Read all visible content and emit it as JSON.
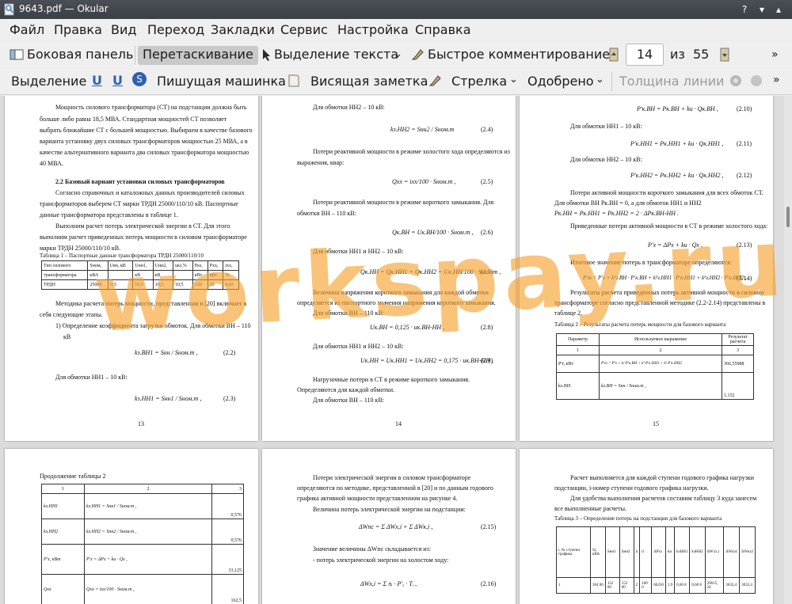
{
  "window": {
    "title": "9643.pdf — Okular"
  },
  "menu": [
    "Файл",
    "Правка",
    "Вид",
    "Переход",
    "Закладки",
    "Сервис",
    "Настройка",
    "Справка"
  ],
  "toolbar1": {
    "sidebar": "Боковая панель",
    "drag": "Перетаскивание",
    "text_select": "Выделение текста",
    "quick_comment": "Быстрое комментирование",
    "page_current": "14",
    "page_of": "из",
    "page_total": "55"
  },
  "toolbar2": {
    "select": "Выделение",
    "typewriter": "Пишущая машинка",
    "note": "Висящая заметка",
    "arrow": "Стрелка",
    "approved": "Одобрено",
    "line_width": "Толщина линии"
  },
  "watermark": "workspay.ru",
  "pages": {
    "p13": {
      "lines": [
        "Мощность силового трансформатора (СТ) на подстанции должна быть",
        "больше либо равна 18,5 МВА. Стандартная мощностей СТ позволяет",
        "выбрать ближайшие СТ с большей мощностью. Выбираем в качестве базового",
        "варианта установку двух силовых трансформаторов мощностью 25 МВА, а в",
        "качестве альтернативного варианта два силовых трансформатора мощностью",
        "40 МВА."
      ],
      "heading": "2.2 Базовый вариант установки силовых трансформаторов",
      "lines2": [
        "Согласно справочных и каталожных данных производителей силовых",
        "трансформаторов выберем СТ марки ТРДН 25000/110/10 кВ. Паспортные",
        "данные трансформатора представлены в таблице 1.",
        "Выполним расчет потерь электрической энергии в СТ. Для этого",
        "выполним расчет приведенных потерь мощности в силовом трансформаторе",
        "марки ТРДН 25000/110/10 кВ."
      ],
      "table_caption": "Таблица 1 – Паспортные данные трансформатора ТРДН 25000/110/10",
      "table_head": [
        "Тип силового",
        "Sном,",
        "Uвн, кВ",
        "Uнн1,",
        "Uнн2,",
        "uкз,%",
        "Ркз,",
        "Рхх,",
        "iхх,"
      ],
      "table_head2": [
        "трансформатора",
        "кВА",
        "",
        "кВ",
        "кВ",
        "",
        "кВт",
        "кВт",
        "%"
      ],
      "table_row": [
        "ТРДН",
        "25000",
        "115",
        "10,5",
        "10,5",
        "10,5",
        "120",
        "25",
        "0,65"
      ],
      "lines3": [
        "Методика расчета потерь мощности, представленная в [20] включает в",
        "себя следующие этапы.",
        "1)  Определение коэффициента загрузки обмоток. Для обмотки ВН – 110",
        "кВ"
      ],
      "eq1": "kз.ВН1 = Sнн / Sном.т ,",
      "eq1_num": "(2.2)",
      "l_nn1": "Для обмотки НН1 – 10 кВ:",
      "eq2": "kз.НН1 = Sнн1 / Sном.т ,",
      "eq2_num": "(2.3)",
      "num": "13"
    },
    "p14": {
      "l1": "Для обмотки НН2 – 10 кВ:",
      "eq1": "kз.НН2 = Sнн2 / Sном.т",
      "eq1_num": "(2.4)",
      "l2": "Потери реактивной мощности в режиме холостого хода определяются из",
      "l3": "выражения, квар:",
      "eq2": "Qхх = iхх/100 · Sном.т ,",
      "eq2_num": "(2.5)",
      "l4": "Потери реактивной мощности в режиме короткого замыкания. Для",
      "l5": "обмотки ВН – 110 кВ:",
      "eq3": "Qк.ВН = Uк.ВН/100 · Sном.т ,",
      "eq3_num": "(2.6)",
      "l6": "Для обмотки НН1 и НН2 – 10 кВ:",
      "eq4": "Qк.НН = Qк.НН1 = Qк.НН2 = Uк.НН/100 · Sном.т ,",
      "eq4_num": "(2.7)",
      "l7": "Величина напряжения короткого замыкания для каждой обмотки",
      "l8": "определяется из паспортного значения напряжения короткого замыкания.",
      "l9": "Для обмотки ВН – 110 кВ:",
      "eq5": "Uк.ВН = 0,125 · uк.ВН-НН ,",
      "eq5_num": "(2.8)",
      "l10": "Для обмотки НН1 и НН2 – 10 кВ:",
      "eq6": "Uк.НН = Uк.НН1 = Uк.НН2 = 0,175 · uк.ВН-НН ,",
      "eq6_num": "(2.9)",
      "l11": "Нагрузочные потери в СТ в режиме короткого замыкания.",
      "l12": "Определяются для каждой обмотки.",
      "l13": "Для обмотки ВН – 110 кВ:",
      "num": "14"
    },
    "p15": {
      "eq1": "P'к.ВН = Pк.ВН + kи · Qк.ВН ,",
      "eq1_num": "(2.10)",
      "l1": "Для обмотки НН1 – 10 кВ:",
      "eq2": "P'к.НН1 = Pк.НН1 + kи · Qк.НН1 ,",
      "eq2_num": "(2.11)",
      "l2": "Для обмотки НН2 – 10 кВ:",
      "eq3": "P'к.НН2 = Pк.НН2 + kи · Qк.НН2 ,",
      "eq3_num": "(2.12)",
      "l3": "Потери активной мощности короткого замыкания для всех обмоток СТ.",
      "l4": "Для обмотки ВН Pк.ВН = 0, а для обмоток НН1 и НН2",
      "l5": "Pк.НН = Pк.НН1 = Pк.НН2 = 2 · ΔPк.ВН-НН .",
      "l6": "Приведенные потери активной мощности в СТ в режиме холостого хода:",
      "eq4": "P'х = ΔPх + kи · Qх ,",
      "eq4_num": "(2.13)",
      "l7": "Итоговое значение потерь в трансформаторе определяются:",
      "eq5": "P'т = P'х + k²з.ВН · P'к.ВН + k²з.НН1 · P'к.НН1 + k²з.НН2 · P'к.НН2 ,",
      "eq5_num": "(2.14)",
      "l8": "Результаты расчета приведенных потерь активной мощности в силовом",
      "l9": "трансформаторе согласно представленной методике (2.2-2.14) представлены в",
      "l10": "таблице 2.",
      "table_caption": "Таблица 2 – Результаты расчета потерь мощности для базового варианта",
      "th": [
        "Параметр",
        "Используемое выражение",
        "Результат расчета"
      ],
      "tn": [
        "1",
        "2",
        "3"
      ],
      "r1": [
        "P'т, кВт",
        "P'т = P'х + k²·P'к.ВН + k²·P'к.НН1 + k²·P'к.НН2",
        "366,55988"
      ],
      "r2": [
        "kз.ВН",
        "kз.ВН = Sнн / Sном.т ,",
        "1,152"
      ],
      "num": "15"
    },
    "p16": {
      "caption": "Продолжение таблицы 2",
      "tn": [
        "1",
        "2",
        "3"
      ],
      "rows": [
        [
          "kз.НН1",
          "kз.НН1 = Sнн1 / Sном.т ,",
          "0,576"
        ],
        [
          "kз.НН2",
          "kз.НН2 = Sнн2 / Sном.т ,",
          "0,576"
        ],
        [
          "P'х, кВт",
          "P'х = ΔPх + kи · Qх ,",
          "33,125"
        ],
        [
          "Qхх",
          "Qхх = iхх/100 · Sном.т ,",
          "162,5"
        ]
      ]
    },
    "p17": {
      "l1": "Потери электрической энергии в силовом трансформаторе",
      "l2": "определяются по методике, представленной в [20] и по данным годового",
      "l3": "графика активной мощности представленном на рисунке 4.",
      "l4": "Величина потерь электрической энергии на подстанции:",
      "eq1": "ΔWпс = Σ ΔWх,i + Σ ΔWк,i ,",
      "eq1_num": "(2.15)",
      "l5": "Значение величины ΔWпс складывается из:",
      "l6": "- потерь электрической энергии на холостом ходу:",
      "eq2": "ΔWх,i = Σ nᵢ · P'ₓ · Tᵢ ,",
      "eq2_num": "(2.16)"
    },
    "p18": {
      "l1": "Расчет выполняется для каждой ступени годового графика нагрузки",
      "l2": "подстанции, i-номер ступени годового графика нагрузки.",
      "l3": "Для удобства выполнения расчетов составим таблицу 3 куда занесем",
      "l4": "все выполненные расчеты.",
      "caption": "Таблица 3 – Определение потерь на подстанции для базового варианта",
      "head": [
        "i, № ступени графика",
        "Si, кВА",
        "Sнн1",
        "Sнн2",
        "n",
        "ti",
        "ΔPхх",
        "kи",
        "kзНН1",
        "kзНН2",
        "ΔWхх,i",
        "ΔWкз1",
        "ΔWкз2"
      ],
      "row": [
        "1",
        "304 00",
        "152 00",
        "152 00",
        "2",
        "100 0",
        "66250",
        "1,9",
        "0,60 8",
        "0,60 8",
        "29615, 24",
        "3032,4",
        "3032,4"
      ]
    }
  }
}
